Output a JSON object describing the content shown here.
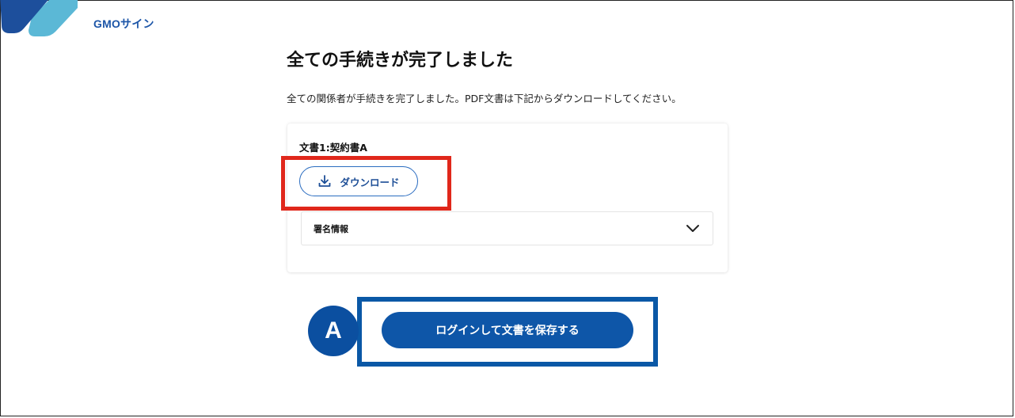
{
  "brand": {
    "logo_text": "GMOサイン",
    "colors": {
      "dark_blue": "#1d4f9c",
      "light_blue": "#5bb8d6"
    }
  },
  "page": {
    "title": "全ての手続きが完了しました",
    "description": "全ての関係者が手続きを完了しました。PDF文書は下記からダウンロードしてください。"
  },
  "document": {
    "name": "文書1:契約書A",
    "download_label": "ダウンロード",
    "download_icon": "download-icon",
    "signature_info_label": "署名情報",
    "signature_info_icon": "chevron-down-icon"
  },
  "actions": {
    "save_label": "ログインして文書を保存する"
  },
  "annotations": {
    "marker_label": "A",
    "highlight_download_color": "#e0271b",
    "highlight_save_color": "#0a58a6"
  }
}
